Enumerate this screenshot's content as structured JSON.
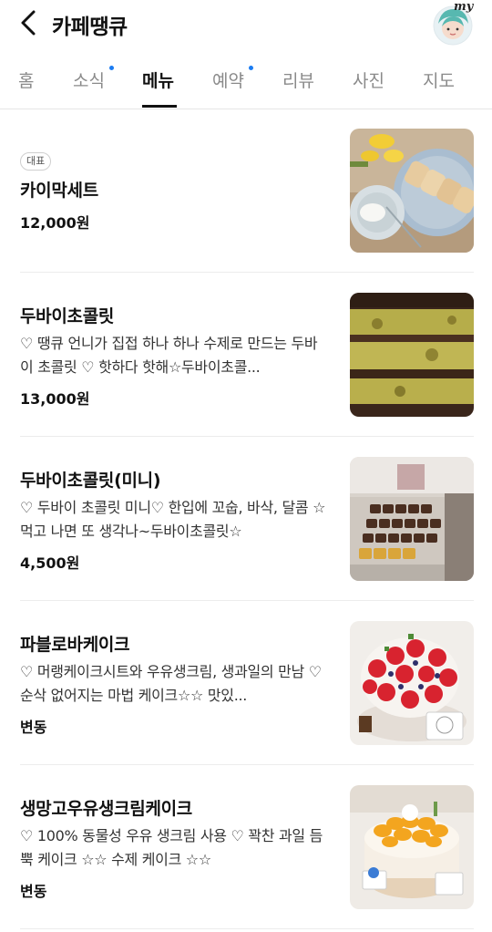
{
  "header": {
    "title": "카페땡큐",
    "avatar_text": "my"
  },
  "tabs": [
    {
      "label": "홈"
    },
    {
      "label": "소식"
    },
    {
      "label": "메뉴"
    },
    {
      "label": "예약"
    },
    {
      "label": "리뷰"
    },
    {
      "label": "사진"
    },
    {
      "label": "지도"
    }
  ],
  "menu": [
    {
      "badge": "대표",
      "name": "카이막세트",
      "desc": "",
      "price": "12,000원"
    },
    {
      "name": "두바이초콜릿",
      "desc": "♡ 땡큐 언니가 집접 하나 하나 수제로 만드는 두바이 초콜릿 ♡ 핫하다 핫해☆두바이초콜...",
      "price": "13,000원"
    },
    {
      "name": "두바이초콜릿(미니)",
      "desc": "♡ 두바이 초콜릿 미니♡ 한입에 꼬숩, 바삭, 달콤 ☆먹고 나면 또 생각나~두바이초콜릿☆",
      "price": "4,500원"
    },
    {
      "name": "파블로바케이크",
      "desc": "♡ 머랭케이크시트와 우유생크림, 생과일의 만남 ♡ 순삭 없어지는 마법 케이크☆☆ 맛있...",
      "price": "변동"
    },
    {
      "name": "생망고우유생크림케이크",
      "desc": "♡ 100% 동물성 우유 생크림 사용 ♡ 꽉찬 과일 듬뿍 케이크 ☆☆ 수제 케이크 ☆☆",
      "price": "변동"
    }
  ]
}
